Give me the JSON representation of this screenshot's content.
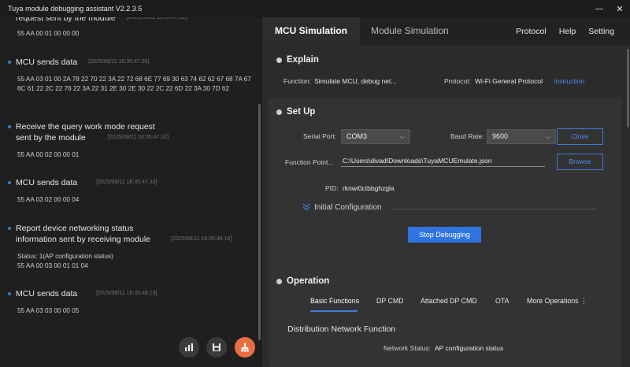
{
  "window": {
    "title": "Tuya module debugging assistant V2.2.3.5",
    "minimize": "—",
    "close": "✕"
  },
  "log": {
    "entries": [
      {
        "text": "request sent by the module",
        "timestamp": "[2025/08/11 18:35:47.02]",
        "body": "55 AA 00 01 00 00 00"
      },
      {
        "text": "MCU sends data",
        "timestamp": "[2025/08/11 18:35:47.05]",
        "body": "55 AA 03 01 00 2A 78 22 70 22 3A 22 72 68 6E 77 69 30 63 74 62 62 67 68 7A 67 6C 61 22 2C 22 76 22 3A 22 31 2E 30 2E 30 22 2C 22 6D 22 3A 30 7D 62"
      },
      {
        "text": "Receive the query work mode request sent by the module",
        "line1": "Receive the query work mode request",
        "line2": "sent by the module",
        "timestamp": "[2025/08/11 18:35:47.32]",
        "body": "55 AA 00 02 00 00 01"
      },
      {
        "text": "MCU sends data",
        "timestamp": "[2025/08/11 18:35:47.33]",
        "body": "55 AA 03 02 00 00 04"
      },
      {
        "line1": "Report device networking status",
        "line2": "information sent by receiving module",
        "timestamp": "[2025/08/11 18:35:48.18]",
        "body1": "Status: 1(AP configuration status)",
        "body2": "55 AA 00 03 00 01 01 04"
      },
      {
        "text": "MCU sends data",
        "timestamp": "[2025/08/11 18:35:48.19]",
        "body": "55 AA 03 03 00 00 05"
      }
    ]
  },
  "tabs": {
    "mcu": "MCU Simulation",
    "module": "Module Simulation"
  },
  "menu": {
    "protocol": "Protocol",
    "help": "Help",
    "setting": "Setting"
  },
  "explain": {
    "title": "Explain",
    "function_label": "Function:",
    "function_value": "Simulate MCU, debug net...",
    "protocol_label": "Protocol:",
    "protocol_value": "Wi-Fi General Protocol",
    "instruction": "Instruction"
  },
  "setup": {
    "title": "Set Up",
    "serial_port_label": "Serial Port:",
    "serial_port_value": "COM3",
    "baud_rate_label": "Baud Rate:",
    "baud_rate_value": "9600",
    "close_button": "Close",
    "function_point_label": "Function Point...",
    "function_point_value": "C:\\Users\\divad\\Downloads\\TuyaMCUEmulate.json",
    "browse_button": "Browse",
    "pid_label": "PID:",
    "pid_value": "rknwi0ctbbghzgla",
    "initial_config": "Initial Configuration",
    "stop_button": "Stop Debugging"
  },
  "operation": {
    "title": "Operation",
    "tabs": [
      "Basic Functions",
      "DP CMD",
      "Attached DP CMD",
      "OTA",
      "More Operations"
    ],
    "more_icon": "⋮",
    "section_title": "Distribution Network Function",
    "network_status_label": "Network Status:",
    "network_status_value": "AP configuration status"
  },
  "icons": {
    "accent": "#e86e43",
    "primary": "#2f74e0"
  }
}
